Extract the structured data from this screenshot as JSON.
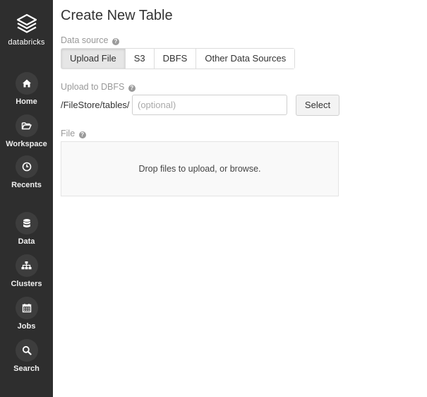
{
  "brand": {
    "name": "databricks",
    "icon": "databricks-logo-icon"
  },
  "sidebar": {
    "items": [
      {
        "label": "Home",
        "icon": "home-icon"
      },
      {
        "label": "Workspace",
        "icon": "folder-open-icon"
      },
      {
        "label": "Recents",
        "icon": "clock-icon"
      },
      {
        "label": "Data",
        "icon": "database-icon"
      },
      {
        "label": "Clusters",
        "icon": "sitemap-icon"
      },
      {
        "label": "Jobs",
        "icon": "calendar-icon"
      },
      {
        "label": "Search",
        "icon": "search-icon"
      }
    ]
  },
  "page": {
    "title": "Create New Table"
  },
  "data_source": {
    "label": "Data source",
    "tabs": [
      "Upload File",
      "S3",
      "DBFS",
      "Other Data Sources"
    ],
    "active_tab": "Upload File"
  },
  "upload_to_dbfs": {
    "label": "Upload to DBFS",
    "path_prefix": "/FileStore/tables/",
    "input_value": "",
    "input_placeholder": "(optional)",
    "select_button": "Select"
  },
  "file": {
    "label": "File",
    "dropzone_text": "Drop files to upload, or browse."
  },
  "colors": {
    "sidebar_bg": "#2e2e2e",
    "sidebar_circle": "#3d3d3d",
    "active_tab_bg": "#e6e6e6",
    "dropzone_bg": "#f9f9f9"
  }
}
